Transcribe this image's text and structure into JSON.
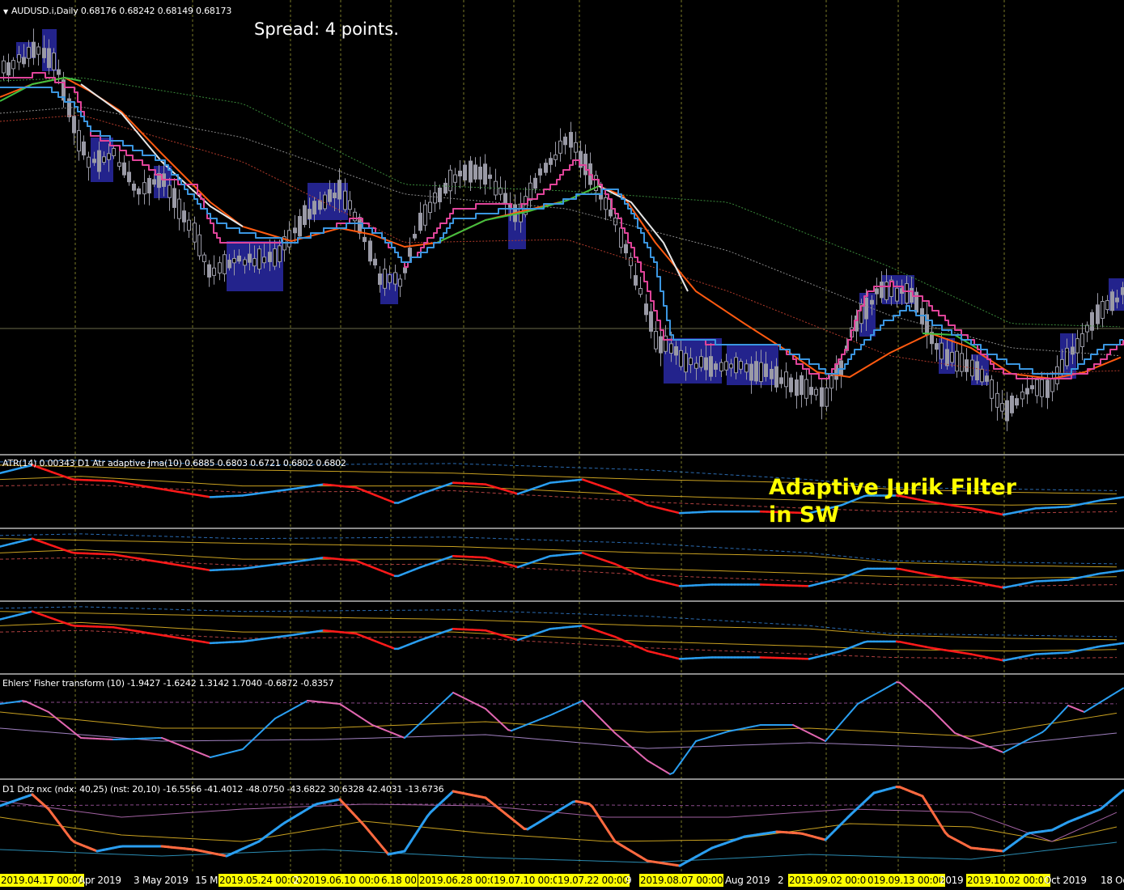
{
  "window": {
    "symbol_header": "AUDUSD.i,Daily  0.68176 0.68242 0.68149 0.68173",
    "spread_text": "Spread: 4 points."
  },
  "indicators": {
    "atr_header": "ATR(14) 0.00343  D1 Atr adaptive Jma(10) 0.6885 0.6803 0.6721 0.6802 0.6802",
    "fisher_header": "Ehlers' Fisher transform (10) -1.9427 -1.6242 1.3142 1.7040 -0.6872 -0.8357",
    "ddz_header": "D1 Ddz nxc (ndx: 40,25) (nst: 20,10) -16.5566 -41.4012 -48.0750 -43.6822 30.6328 42.4031 -13.6736"
  },
  "annotation": {
    "line1": "Adaptive Jurik Filter",
    "line2": "in SW"
  },
  "xaxis": [
    {
      "label": "2019.04.17 00:00",
      "highlight": true
    },
    {
      "label": "Apr 2019",
      "highlight": false
    },
    {
      "label": "3 May 2019",
      "highlight": false
    },
    {
      "label": "15 M",
      "highlight": false
    },
    {
      "label": "2019.05.24 00:00",
      "highlight": true
    },
    {
      "label": "2",
      "highlight": false
    },
    {
      "label": "2019.06.10 00:00",
      "highlight": true
    },
    {
      "label": "6.18 00",
      "highlight": true
    },
    {
      "label": "2019.06.28 00:00",
      "highlight": true
    },
    {
      "label": "19.07.10 00:00",
      "highlight": true
    },
    {
      "label": "19.07.22 00:00",
      "highlight": true
    },
    {
      "label": "9",
      "highlight": false
    },
    {
      "label": "2019.08.07 00:00",
      "highlight": true
    },
    {
      "label": "Aug 2019",
      "highlight": false
    },
    {
      "label": "2",
      "highlight": false
    },
    {
      "label": "2019.09.02 00:00",
      "highlight": true
    },
    {
      "label": "019.09.13 00:00",
      "highlight": true
    },
    {
      "label": "2019",
      "highlight": false
    },
    {
      "label": "2019.10.02 00:00",
      "highlight": true
    },
    {
      "label": "Oct 2019",
      "highlight": false
    },
    {
      "label": "18 Oc",
      "highlight": false
    }
  ],
  "colors": {
    "background": "#000000",
    "candle": "#9a9aa6",
    "box": "#23238c",
    "pink_line": "#e0449a",
    "blue_line": "#3b96e0",
    "orange_line": "#ff5a10",
    "white_line": "#e6e6e6",
    "green_line": "#40c040",
    "indicator_up": "#2a9ef0",
    "indicator_down": "#ff1a1a",
    "fisher_down": "#e066b0",
    "ddz_down": "#ff6a40",
    "highlight_label": "#ffff00",
    "annotation": "#ffff00"
  }
}
